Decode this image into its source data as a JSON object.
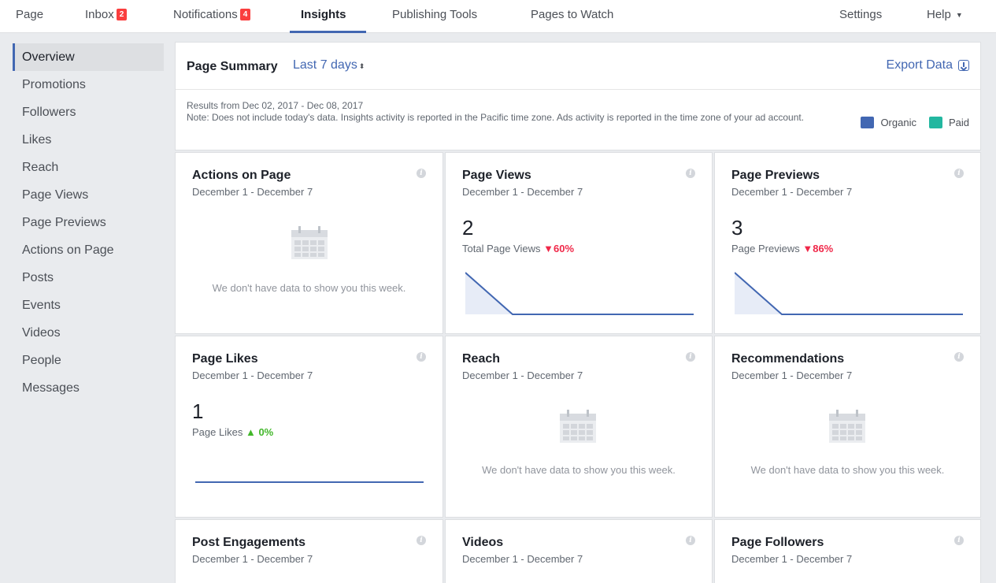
{
  "nav": {
    "page": "Page",
    "inbox": "Inbox",
    "inbox_badge": "2",
    "notifications": "Notifications",
    "notifications_badge": "4",
    "insights": "Insights",
    "publishing_tools": "Publishing Tools",
    "pages_to_watch": "Pages to Watch",
    "settings": "Settings",
    "help": "Help"
  },
  "sidebar": {
    "items": [
      "Overview",
      "Promotions",
      "Followers",
      "Likes",
      "Reach",
      "Page Views",
      "Page Previews",
      "Actions on Page",
      "Posts",
      "Events",
      "Videos",
      "People",
      "Messages"
    ],
    "active": "Overview"
  },
  "summary": {
    "title": "Page Summary",
    "range": "Last 7 days",
    "export": "Export Data",
    "results": "Results from Dec 02, 2017 - Dec 08, 2017",
    "note": "Note: Does not include today's data. Insights activity is reported in the Pacific time zone. Ads activity is reported in the time zone of your ad account.",
    "legend": [
      {
        "label": "Organic",
        "color": "#4267b2"
      },
      {
        "label": "Paid",
        "color": "#23b7a0"
      }
    ]
  },
  "cards": {
    "actions": {
      "title": "Actions on Page",
      "range": "December 1 - December 7",
      "nodata": "We don't have data to show you this week."
    },
    "views": {
      "title": "Page Views",
      "range": "December 1 - December 7",
      "value": "2",
      "label": "Total Page Views",
      "change": "60%",
      "trend": "down",
      "series": [
        1,
        0,
        0,
        0,
        0,
        0
      ]
    },
    "previews": {
      "title": "Page Previews",
      "range": "December 1 - December 7",
      "value": "3",
      "label": "Page Previews",
      "change": "86%",
      "trend": "down",
      "series": [
        1,
        0,
        0,
        0,
        0,
        0
      ]
    },
    "likes": {
      "title": "Page Likes",
      "range": "December 1 - December 7",
      "value": "1",
      "label": "Page Likes",
      "change": "0%",
      "trend": "up",
      "series": [
        0,
        0,
        0,
        0,
        0,
        0
      ]
    },
    "reach": {
      "title": "Reach",
      "range": "December 1 - December 7",
      "nodata": "We don't have data to show you this week."
    },
    "recommendations": {
      "title": "Recommendations",
      "range": "December 1 - December 7",
      "nodata": "We don't have data to show you this week."
    },
    "engagements": {
      "title": "Post Engagements",
      "range": "December 1 - December 7"
    },
    "videos": {
      "title": "Videos",
      "range": "December 1 - December 7"
    },
    "followers": {
      "title": "Page Followers",
      "range": "December 1 - December 7"
    }
  },
  "colors": {
    "accent": "#4267b2",
    "down": "#f02849",
    "up": "#42b72a",
    "badge": "#fa3e3e"
  }
}
